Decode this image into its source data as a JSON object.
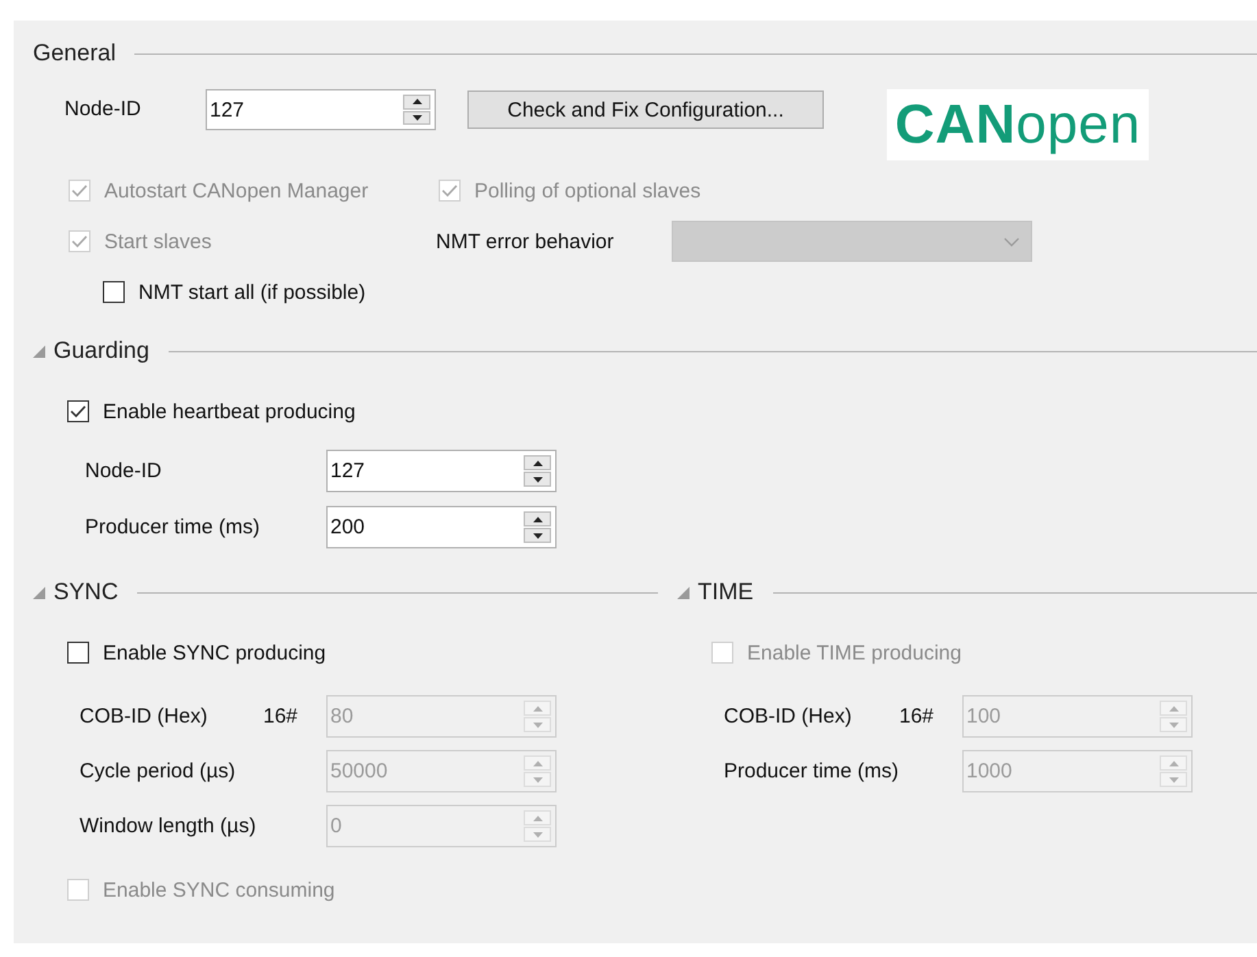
{
  "general": {
    "title": "General",
    "node_id": {
      "label": "Node-ID",
      "value": "127",
      "disabled": false
    },
    "check_button": {
      "label": "Check and Fix Configuration..."
    },
    "logo": {
      "text": "**CAN**open"
    },
    "options": [
      {
        "label": "Autostart CANopen Manager",
        "checked": true,
        "disabled": true
      },
      {
        "label": "Polling of optional slaves",
        "checked": true,
        "disabled": true
      },
      {
        "label": "Start slaves",
        "checked": true,
        "disabled": true
      },
      {
        "label": "NMT start all (if possible)",
        "checked": false,
        "disabled": false
      }
    ],
    "nmt_error_behavior": {
      "label": "NMT error behavior",
      "disabled": true
    }
  },
  "guarding": {
    "title": "Guarding",
    "expanded": true,
    "heartbeat": {
      "label": "Enable heartbeat producing",
      "checked": true,
      "disabled": false
    },
    "fields": [
      {
        "label": "Node-ID",
        "value": "127",
        "disabled": false
      },
      {
        "label": "Producer time (ms)",
        "value": "200",
        "disabled": false
      }
    ]
  },
  "sync": {
    "title": "SYNC",
    "expanded": true,
    "producing": {
      "label": "Enable SYNC producing",
      "checked": false,
      "disabled": false
    },
    "fields": [
      {
        "label": "COB-ID (Hex)",
        "prefix": "16#",
        "value": "80",
        "disabled": true
      },
      {
        "label": "Cycle period (µs)",
        "value": "50000",
        "disabled": true
      },
      {
        "label": "Window length (µs)",
        "value": "0",
        "disabled": true
      }
    ],
    "consuming": {
      "label": "Enable SYNC consuming",
      "checked": false,
      "disabled": true
    }
  },
  "time": {
    "title": "TIME",
    "expanded": true,
    "producing": {
      "label": "Enable TIME producing",
      "checked": false,
      "disabled": true
    },
    "fields": [
      {
        "label": "COB-ID (Hex)",
        "prefix": "16#",
        "value": "100",
        "disabled": true
      },
      {
        "label": "Producer time (ms)",
        "value": "1000",
        "disabled": true
      }
    ]
  }
}
